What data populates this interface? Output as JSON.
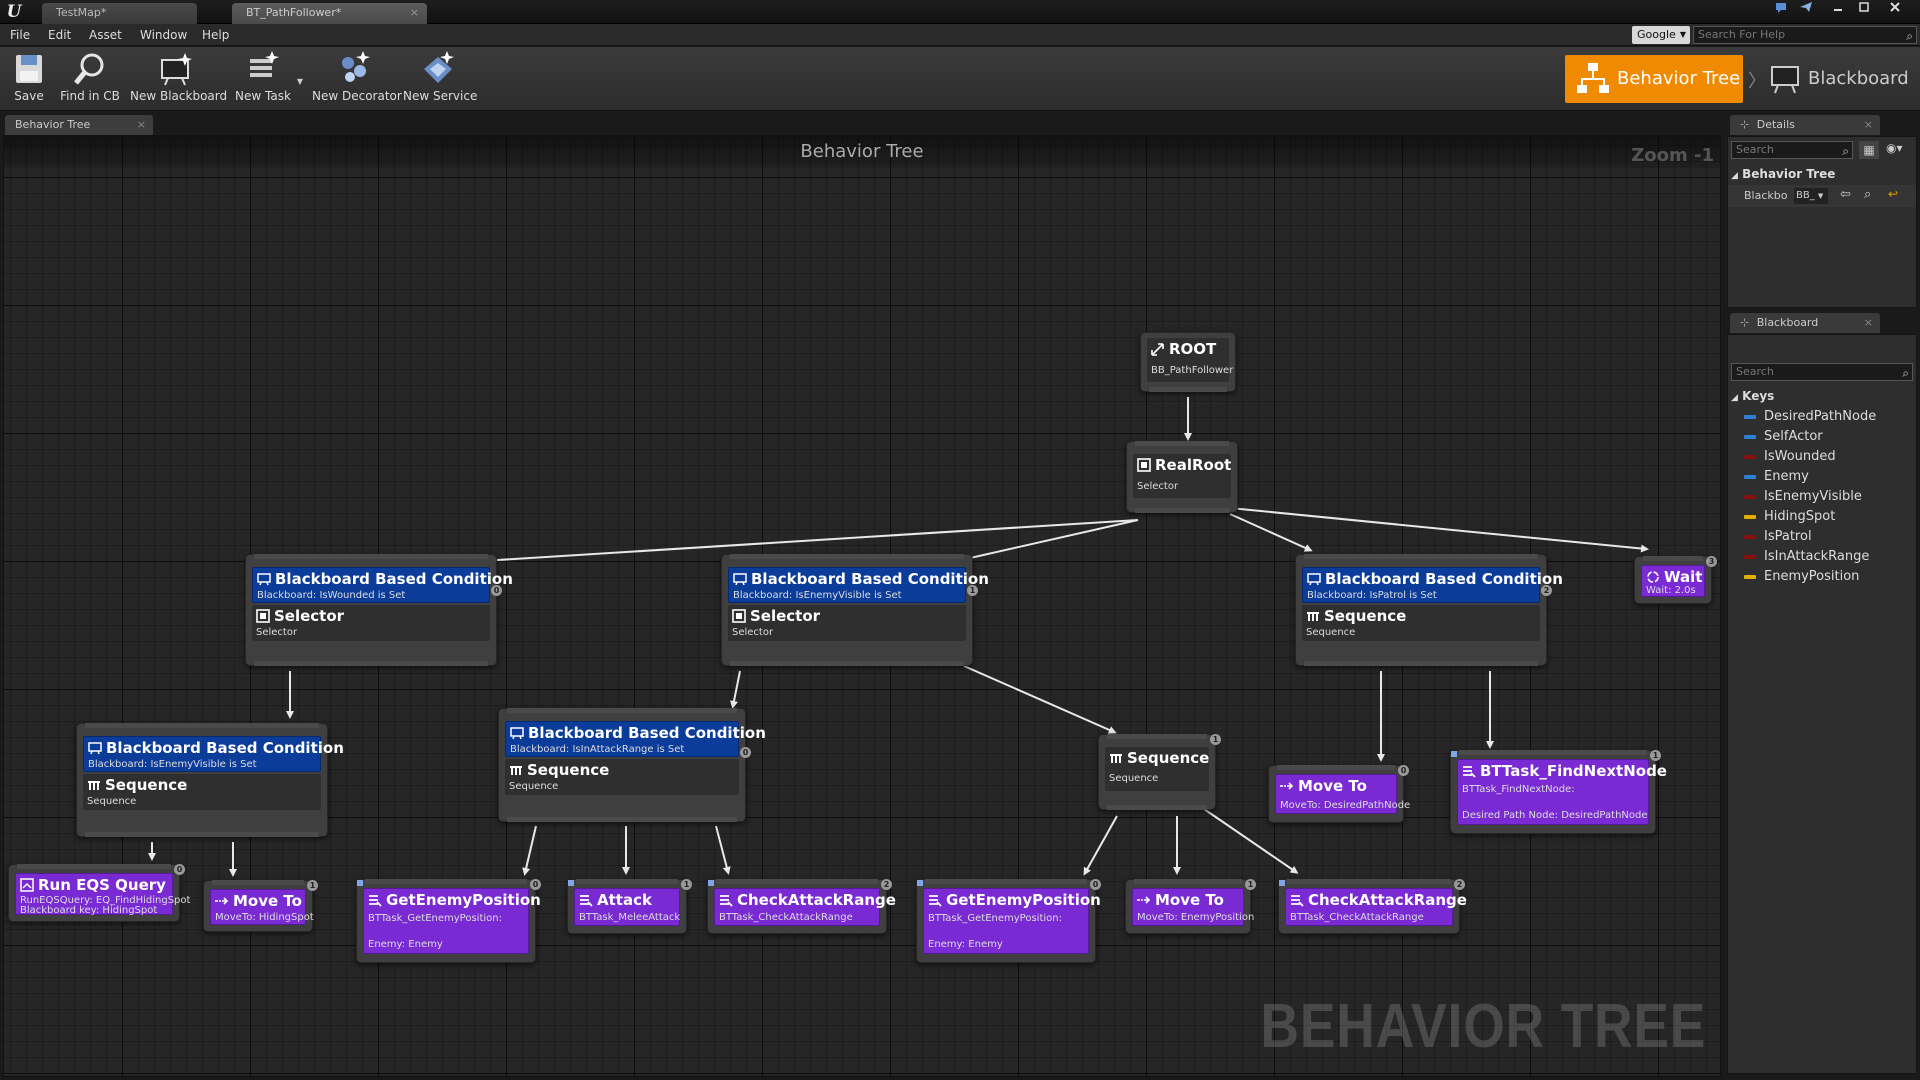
{
  "titlebar": {
    "tabs": [
      {
        "label": "TestMap*"
      },
      {
        "label": "BT_PathFollower*",
        "close": "×"
      }
    ]
  },
  "menu": {
    "items": [
      "File",
      "Edit",
      "Asset",
      "Window",
      "Help"
    ],
    "search_engine": "Google",
    "help_search_placeholder": "Search For Help"
  },
  "toolbar": {
    "buttons": [
      {
        "label": "Save",
        "icon": "save-icon"
      },
      {
        "label": "Find in CB",
        "icon": "magnifier-icon"
      },
      {
        "label": "New Blackboard",
        "icon": "new-blackboard-icon"
      },
      {
        "label": "New Task",
        "icon": "new-task-icon"
      },
      {
        "label": "New Decorator",
        "icon": "new-decorator-icon"
      },
      {
        "label": "New Service",
        "icon": "new-service-icon"
      }
    ],
    "modes": {
      "behavior_tree": "Behavior Tree",
      "blackboard": "Blackboard"
    },
    "accent": "#f08a00"
  },
  "graph": {
    "tab_label": "Behavior Tree",
    "header": "Behavior Tree",
    "zoom": "Zoom -1",
    "watermark": "BEHAVIOR TREE",
    "nodes": {
      "root": {
        "title": "ROOT",
        "sub": "BB_PathFollower"
      },
      "realroot": {
        "title": "RealRoot",
        "sub": "Selector"
      },
      "bbc_wounded": {
        "dec_title": "Blackboard Based Condition",
        "dec_sub": "Blackboard: IsWounded is Set",
        "title": "Selector",
        "sub": "Selector",
        "index": "0"
      },
      "bbc_visible": {
        "dec_title": "Blackboard Based Condition",
        "dec_sub": "Blackboard: IsEnemyVisible is Set",
        "title": "Selector",
        "sub": "Selector",
        "index": "1"
      },
      "bbc_patrol": {
        "dec_title": "Blackboard Based Condition",
        "dec_sub": "Blackboard: IsPatrol is Set",
        "title": "Sequence",
        "sub": "Sequence",
        "index": "2"
      },
      "wait": {
        "title": "Wait",
        "sub": "Wait: 2.0s",
        "index": "3"
      },
      "bbc_visible2": {
        "dec_title": "Blackboard Based Condition",
        "dec_sub": "Blackboard: IsEnemyVisible is Set",
        "title": "Sequence",
        "sub": "Sequence"
      },
      "bbc_attack": {
        "dec_title": "Blackboard Based Condition",
        "dec_sub": "Blackboard: IsInAttackRange is Set",
        "title": "Sequence",
        "sub": "Sequence",
        "index": "0"
      },
      "seq_mid": {
        "title": "Sequence",
        "sub": "Sequence",
        "index": "1"
      },
      "moveto_path": {
        "title": "Move To",
        "sub": "MoveTo: DesiredPathNode",
        "index": "0"
      },
      "findnext": {
        "title": "BTTask_FindNextNode",
        "sub1": "BTTask_FindNextNode:",
        "sub2": "Desired Path Node: DesiredPathNode",
        "index": "1"
      },
      "eqs": {
        "title": "Run EQS Query",
        "sub1": "RunEQSQuery: EQ_FindHidingSpot",
        "sub2": "Blackboard key: HidingSpot",
        "index": "0"
      },
      "moveto_hide": {
        "title": "Move To",
        "sub": "MoveTo: HidingSpot",
        "index": "1"
      },
      "getenemy1": {
        "title": "GetEnemyPosition",
        "sub1": "BTTask_GetEnemyPosition:",
        "sub2": "Enemy: Enemy",
        "index": "0"
      },
      "attack": {
        "title": "Attack",
        "sub": "BTTask_MeleeAttack",
        "index": "1"
      },
      "checkrange1": {
        "title": "CheckAttackRange",
        "sub": "BTTask_CheckAttackRange",
        "index": "2"
      },
      "getenemy2": {
        "title": "GetEnemyPosition",
        "sub1": "BTTask_GetEnemyPosition:",
        "sub2": "Enemy: Enemy",
        "index": "0"
      },
      "moveto_enemy": {
        "title": "Move To",
        "sub": "MoveTo: EnemyPosition",
        "index": "1"
      },
      "checkrange2": {
        "title": "CheckAttackRange",
        "sub": "BTTask_CheckAttackRange",
        "index": "2"
      }
    }
  },
  "details": {
    "tab": "Details",
    "search_placeholder": "Search",
    "category": "Behavior Tree",
    "row_label": "Blackbo",
    "row_value": "BB_"
  },
  "blackboard": {
    "tab": "Blackboard",
    "search_placeholder": "Search",
    "category": "Keys",
    "keys": [
      {
        "label": "DesiredPathNode",
        "color": "#2f7fd8"
      },
      {
        "label": "SelfActor",
        "color": "#2f7fd8"
      },
      {
        "label": "IsWounded",
        "color": "#8a1010"
      },
      {
        "label": "Enemy",
        "color": "#2f7fd8"
      },
      {
        "label": "IsEnemyVisible",
        "color": "#8a1010"
      },
      {
        "label": "HidingSpot",
        "color": "#e0b000"
      },
      {
        "label": "IsPatrol",
        "color": "#8a1010"
      },
      {
        "label": "IsInAttackRange",
        "color": "#8a1010"
      },
      {
        "label": "EnemyPosition",
        "color": "#e0b000"
      }
    ]
  }
}
